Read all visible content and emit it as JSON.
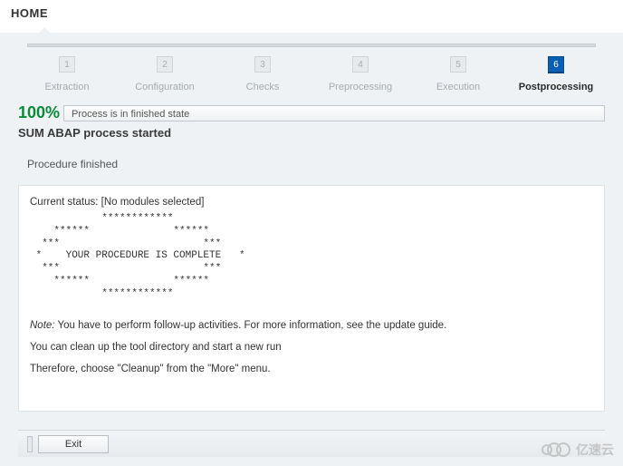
{
  "nav": {
    "home": "HOME"
  },
  "stepper": {
    "steps": [
      {
        "num": "1",
        "label": "Extraction"
      },
      {
        "num": "2",
        "label": "Configuration"
      },
      {
        "num": "3",
        "label": "Checks"
      },
      {
        "num": "4",
        "label": "Preprocessing"
      },
      {
        "num": "5",
        "label": "Execution"
      },
      {
        "num": "6",
        "label": "Postprocessing"
      }
    ],
    "active_index": 5
  },
  "progress": {
    "percent": "100%",
    "message": "Process is in finished state"
  },
  "headings": {
    "subtitle": "SUM ABAP process started",
    "procedure": "Procedure finished"
  },
  "status": {
    "prefix": "Current status: ",
    "value": "[No modules selected]"
  },
  "ascii_art": "            ************\n    ******              ******\n  ***                        ***\n *    YOUR PROCEDURE IS COMPLETE   *\n  ***                        ***\n    ******              ******\n            ************",
  "notes": {
    "note_label": "Note:",
    "note_text": " You have to perform follow-up activities. For more information, see the update guide.",
    "cleanup1": "You can clean up the tool directory and start a new run",
    "cleanup2": "Therefore, choose \"Cleanup\" from the \"More\" menu."
  },
  "footer": {
    "exit": "Exit"
  },
  "watermark": "亿速云"
}
